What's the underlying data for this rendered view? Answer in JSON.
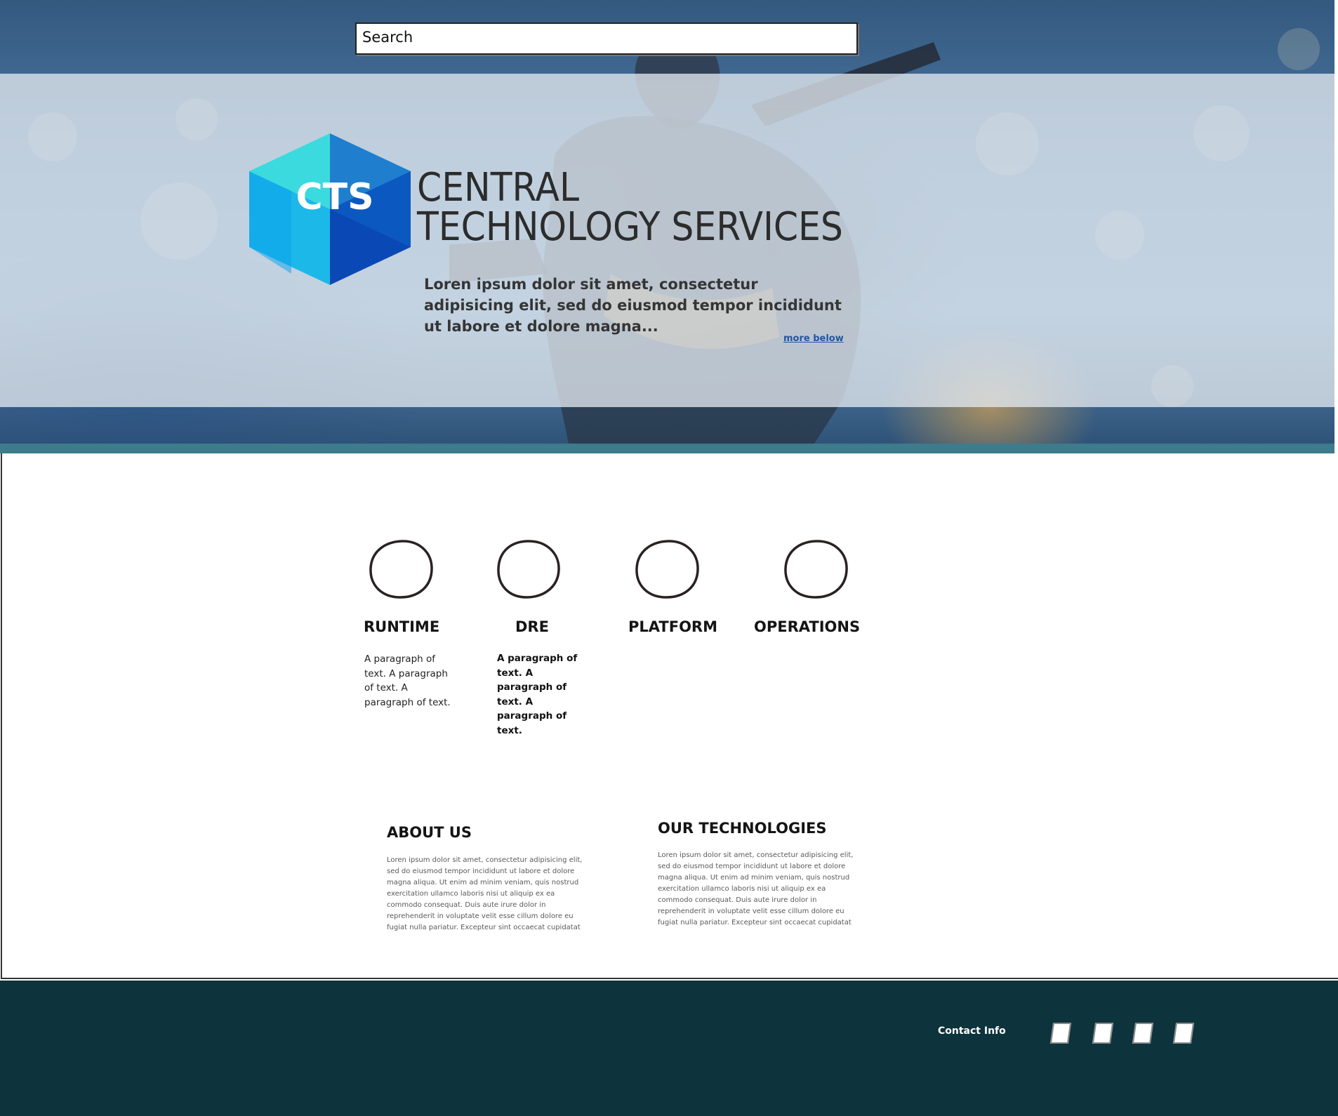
{
  "search": {
    "placeholder": "Search"
  },
  "brand": {
    "logo_letters": "CTS",
    "line1": "CENTRAL",
    "line2": "TECHNOLOGY SERVICES"
  },
  "hero": {
    "tagline": "Loren ipsum dolor sit amet, consectetur adipisicing elit, sed do eiusmod tempor incididunt ut labore et dolore magna...",
    "more_link": "more below"
  },
  "services": [
    {
      "title": "RUNTIME",
      "text": "A paragraph of text. A paragraph of text. A paragraph of text."
    },
    {
      "title": "DRE",
      "text": "A paragraph of text. A paragraph of text. A paragraph of text."
    },
    {
      "title": "PLATFORM",
      "text": ""
    },
    {
      "title": "OPERATIONS",
      "text": ""
    }
  ],
  "about": {
    "title": "ABOUT US",
    "text": "Loren ipsum dolor sit amet, consectetur adipisicing elit, sed do eiusmod tempor incididunt ut labore et dolore magna aliqua. Ut enim ad minim veniam, quis nostrud exercitation ullamco laboris nisi ut aliquip ex ea commodo consequat. Duis aute irure dolor in reprehenderit in voluptate velit esse cillum dolore eu fugiat nulla pariatur. Excepteur sint occaecat cupidatat"
  },
  "technologies": {
    "title": "OUR TECHNOLOGIES",
    "text": "Loren ipsum dolor sit amet, consectetur adipisicing elit, sed do eiusmod tempor incididunt ut labore et dolore magna aliqua. Ut enim ad minim veniam, quis nostrud exercitation ullamco laboris nisi ut aliquip ex ea commodo consequat. Duis aute irure dolor in reprehenderit in voluptate velit esse cillum dolore eu fugiat nulla pariatur. Excepteur sint occaecat cupidatat"
  },
  "footer": {
    "contact_label": "Contact Info",
    "social_icons": [
      "social-icon-1",
      "social-icon-2",
      "social-icon-3",
      "social-icon-4"
    ]
  },
  "colors": {
    "hero_rule": "#3e7b8c",
    "footer_bg": "#0d333d",
    "link": "#1f56a5",
    "cube_light": "#27d3d6",
    "cube_dark": "#0b3aa4"
  }
}
